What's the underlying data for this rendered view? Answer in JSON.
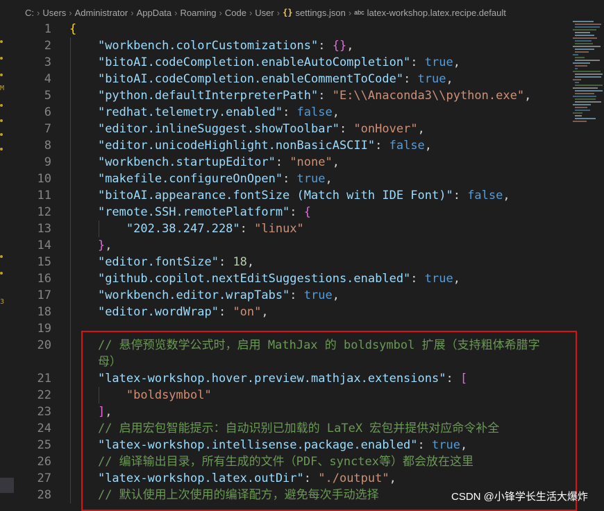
{
  "breadcrumb": {
    "path": [
      "C:",
      "Users",
      "Administrator",
      "AppData",
      "Roaming",
      "Code",
      "User"
    ],
    "file_icon": "{}",
    "file": "settings.json",
    "symbol_icon": "abc",
    "symbol": "latex-workshop.latex.recipe.default",
    "separator": "›"
  },
  "editor": {
    "lines": [
      {
        "n": "1",
        "parts": [
          {
            "t": "{",
            "c": "brace"
          }
        ]
      },
      {
        "n": "2",
        "parts": [
          {
            "t": "    "
          },
          {
            "t": "\"workbench.colorCustomizations\"",
            "c": "key"
          },
          {
            "t": ": "
          },
          {
            "t": "{}",
            "c": "bracket"
          },
          {
            "t": ","
          }
        ]
      },
      {
        "n": "3",
        "parts": [
          {
            "t": "    "
          },
          {
            "t": "\"bitoAI.codeCompletion.enableAutoCompletion\"",
            "c": "key"
          },
          {
            "t": ": "
          },
          {
            "t": "true",
            "c": "kw"
          },
          {
            "t": ","
          }
        ]
      },
      {
        "n": "4",
        "parts": [
          {
            "t": "    "
          },
          {
            "t": "\"bitoAI.codeCompletion.enableCommentToCode\"",
            "c": "key"
          },
          {
            "t": ": "
          },
          {
            "t": "true",
            "c": "kw"
          },
          {
            "t": ","
          }
        ]
      },
      {
        "n": "5",
        "parts": [
          {
            "t": "    "
          },
          {
            "t": "\"python.defaultInterpreterPath\"",
            "c": "key"
          },
          {
            "t": ": "
          },
          {
            "t": "\"E:\\\\Anaconda3\\\\python.exe\"",
            "c": "str"
          },
          {
            "t": ","
          }
        ]
      },
      {
        "n": "6",
        "parts": [
          {
            "t": "    "
          },
          {
            "t": "\"redhat.telemetry.enabled\"",
            "c": "key"
          },
          {
            "t": ": "
          },
          {
            "t": "false",
            "c": "kw"
          },
          {
            "t": ","
          }
        ]
      },
      {
        "n": "7",
        "parts": [
          {
            "t": "    "
          },
          {
            "t": "\"editor.inlineSuggest.showToolbar\"",
            "c": "key"
          },
          {
            "t": ": "
          },
          {
            "t": "\"onHover\"",
            "c": "str"
          },
          {
            "t": ","
          }
        ]
      },
      {
        "n": "8",
        "parts": [
          {
            "t": "    "
          },
          {
            "t": "\"editor.unicodeHighlight.nonBasicASCII\"",
            "c": "key"
          },
          {
            "t": ": "
          },
          {
            "t": "false",
            "c": "kw"
          },
          {
            "t": ","
          }
        ]
      },
      {
        "n": "9",
        "parts": [
          {
            "t": "    "
          },
          {
            "t": "\"workbench.startupEditor\"",
            "c": "key"
          },
          {
            "t": ": "
          },
          {
            "t": "\"none\"",
            "c": "str"
          },
          {
            "t": ","
          }
        ]
      },
      {
        "n": "10",
        "parts": [
          {
            "t": "    "
          },
          {
            "t": "\"makefile.configureOnOpen\"",
            "c": "key"
          },
          {
            "t": ": "
          },
          {
            "t": "true",
            "c": "kw"
          },
          {
            "t": ","
          }
        ]
      },
      {
        "n": "11",
        "parts": [
          {
            "t": "    "
          },
          {
            "t": "\"bitoAI.appearance.fontSize (Match with IDE Font)\"",
            "c": "key"
          },
          {
            "t": ": "
          },
          {
            "t": "false",
            "c": "kw"
          },
          {
            "t": ","
          }
        ]
      },
      {
        "n": "12",
        "parts": [
          {
            "t": "    "
          },
          {
            "t": "\"remote.SSH.remotePlatform\"",
            "c": "key"
          },
          {
            "t": ": "
          },
          {
            "t": "{",
            "c": "bracket"
          }
        ]
      },
      {
        "n": "13",
        "parts": [
          {
            "t": "        "
          },
          {
            "t": "\"202.38.247.228\"",
            "c": "key"
          },
          {
            "t": ": "
          },
          {
            "t": "\"linux\"",
            "c": "str"
          }
        ]
      },
      {
        "n": "14",
        "parts": [
          {
            "t": "    "
          },
          {
            "t": "}",
            "c": "bracket"
          },
          {
            "t": ","
          }
        ]
      },
      {
        "n": "15",
        "parts": [
          {
            "t": "    "
          },
          {
            "t": "\"editor.fontSize\"",
            "c": "key"
          },
          {
            "t": ": "
          },
          {
            "t": "18",
            "c": "num"
          },
          {
            "t": ","
          }
        ]
      },
      {
        "n": "16",
        "parts": [
          {
            "t": "    "
          },
          {
            "t": "\"github.copilot.nextEditSuggestions.enabled\"",
            "c": "key"
          },
          {
            "t": ": "
          },
          {
            "t": "true",
            "c": "kw"
          },
          {
            "t": ","
          }
        ]
      },
      {
        "n": "17",
        "parts": [
          {
            "t": "    "
          },
          {
            "t": "\"workbench.editor.wrapTabs\"",
            "c": "key"
          },
          {
            "t": ": "
          },
          {
            "t": "true",
            "c": "kw"
          },
          {
            "t": ","
          }
        ]
      },
      {
        "n": "18",
        "parts": [
          {
            "t": "    "
          },
          {
            "t": "\"editor.wordWrap\"",
            "c": "key"
          },
          {
            "t": ": "
          },
          {
            "t": "\"on\"",
            "c": "str"
          },
          {
            "t": ","
          }
        ]
      },
      {
        "n": "19",
        "parts": []
      },
      {
        "n": "20",
        "parts": [
          {
            "t": "    "
          },
          {
            "t": "// 悬停预览数学公式时，启用 MathJax 的 boldsymbol 扩展（支持粗体希腊字",
            "c": "cmt"
          }
        ]
      },
      {
        "n": "",
        "parts": [
          {
            "t": "    "
          },
          {
            "t": "母）",
            "c": "cmt"
          }
        ]
      },
      {
        "n": "21",
        "parts": [
          {
            "t": "    "
          },
          {
            "t": "\"latex-workshop.hover.preview.mathjax.extensions\"",
            "c": "key"
          },
          {
            "t": ": "
          },
          {
            "t": "[",
            "c": "bracket"
          }
        ]
      },
      {
        "n": "22",
        "parts": [
          {
            "t": "        "
          },
          {
            "t": "\"boldsymbol\"",
            "c": "str"
          }
        ]
      },
      {
        "n": "23",
        "parts": [
          {
            "t": "    "
          },
          {
            "t": "]",
            "c": "bracket"
          },
          {
            "t": ","
          }
        ]
      },
      {
        "n": "24",
        "parts": [
          {
            "t": "    "
          },
          {
            "t": "// 启用宏包智能提示：自动识别已加载的 LaTeX 宏包并提供对应命令补全",
            "c": "cmt"
          }
        ]
      },
      {
        "n": "25",
        "parts": [
          {
            "t": "    "
          },
          {
            "t": "\"latex-workshop.intellisense.package.enabled\"",
            "c": "key"
          },
          {
            "t": ": "
          },
          {
            "t": "true",
            "c": "kw"
          },
          {
            "t": ","
          }
        ]
      },
      {
        "n": "26",
        "parts": [
          {
            "t": "    "
          },
          {
            "t": "// 编译输出目录，所有生成的文件（PDF、synctex等）都会放在这里",
            "c": "cmt"
          }
        ]
      },
      {
        "n": "27",
        "parts": [
          {
            "t": "    "
          },
          {
            "t": "\"latex-workshop.latex.outDir\"",
            "c": "key"
          },
          {
            "t": ": "
          },
          {
            "t": "\"./output\"",
            "c": "str"
          },
          {
            "t": ","
          }
        ]
      },
      {
        "n": "28",
        "parts": [
          {
            "t": "    "
          },
          {
            "t": "// 默认使用上次使用的编译配方，避免每次手动选择",
            "c": "cmt"
          }
        ]
      }
    ]
  },
  "watermark": "CSDN @小锋学长生活大爆炸",
  "colors": {
    "background": "#1e1e1e",
    "key": "#9cdcfe",
    "string": "#ce9178",
    "keyword": "#569cd6",
    "number": "#b5cea8",
    "comment": "#6a9955",
    "highlight_box": "#e01010"
  }
}
